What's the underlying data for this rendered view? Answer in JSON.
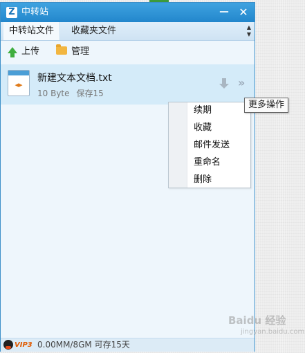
{
  "window": {
    "title": "中转站",
    "logo": "Z",
    "minimize": "－",
    "close": "✕"
  },
  "tabs": [
    {
      "label": "中转站文件"
    },
    {
      "label": "收藏夹文件"
    }
  ],
  "toolbar": {
    "upload_label": "上传",
    "manage_label": "管理"
  },
  "file": {
    "name": "新建文本文档.txt",
    "size": "10 Byte",
    "retention": "保存15"
  },
  "tooltip": "更多操作",
  "context_menu": {
    "items": [
      "续期",
      "收藏",
      "邮件发送",
      "重命名",
      "删除"
    ]
  },
  "status": {
    "badge": "VIP3",
    "text": "0.00MM/8GM 可存15天"
  },
  "watermark": {
    "main": "Baidu 经验",
    "sub": "jingyan.baidu.com"
  },
  "colors": {
    "titlebar": "#2286cc",
    "selected_row": "#d4ebf9",
    "upload_arrow": "#3fae3f",
    "folder": "#f2b640"
  }
}
